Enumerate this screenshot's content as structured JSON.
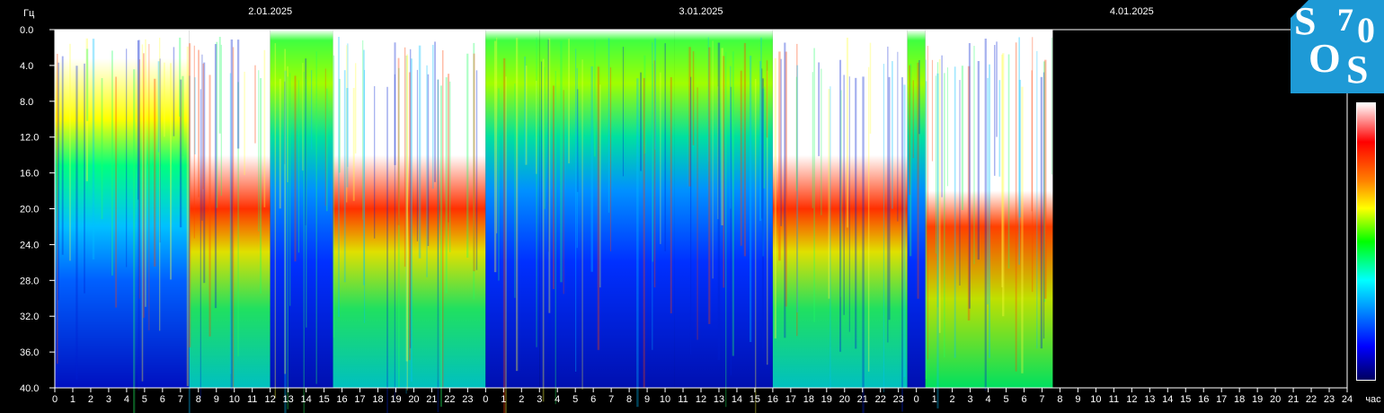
{
  "chart_data": {
    "type": "heatmap",
    "title": "",
    "ylabel": "Гц",
    "xlabel": "час",
    "ylim": [
      0,
      40
    ],
    "y_ticks": [
      "0.0",
      "4.0",
      "8.0",
      "12.0",
      "16.0",
      "20.0",
      "24.0",
      "28.0",
      "32.0",
      "36.0",
      "40.0"
    ],
    "date_labels": [
      "2.01.2025",
      "3.01.2025",
      "4.01.2025"
    ],
    "x_ticks": [
      "0",
      "1",
      "2",
      "3",
      "4",
      "5",
      "6",
      "7",
      "8",
      "9",
      "10",
      "11",
      "12",
      "13",
      "14",
      "15",
      "16",
      "17",
      "18",
      "19",
      "20",
      "21",
      "22",
      "23",
      "0",
      "1",
      "2",
      "3",
      "4",
      "5",
      "6",
      "7",
      "8",
      "9",
      "10",
      "11",
      "12",
      "13",
      "14",
      "15",
      "16",
      "17",
      "18",
      "19",
      "20",
      "21",
      "22",
      "23",
      "0",
      "1",
      "2",
      "3",
      "4",
      "5",
      "6",
      "7",
      "8",
      "9",
      "10",
      "11",
      "12",
      "13",
      "14",
      "15",
      "16",
      "17",
      "18",
      "19",
      "20",
      "21",
      "22",
      "23",
      "24"
    ],
    "data_end_hour": 55.6,
    "colormap": [
      "#ffffff",
      "#ff0000",
      "#ff8000",
      "#ffff00",
      "#00ff00",
      "#00ffff",
      "#0080ff",
      "#0000ff",
      "#000060"
    ]
  },
  "logo": {
    "letters": [
      "S",
      "7",
      "0",
      "O",
      "S"
    ],
    "bg_color": "#1e9ad6"
  }
}
